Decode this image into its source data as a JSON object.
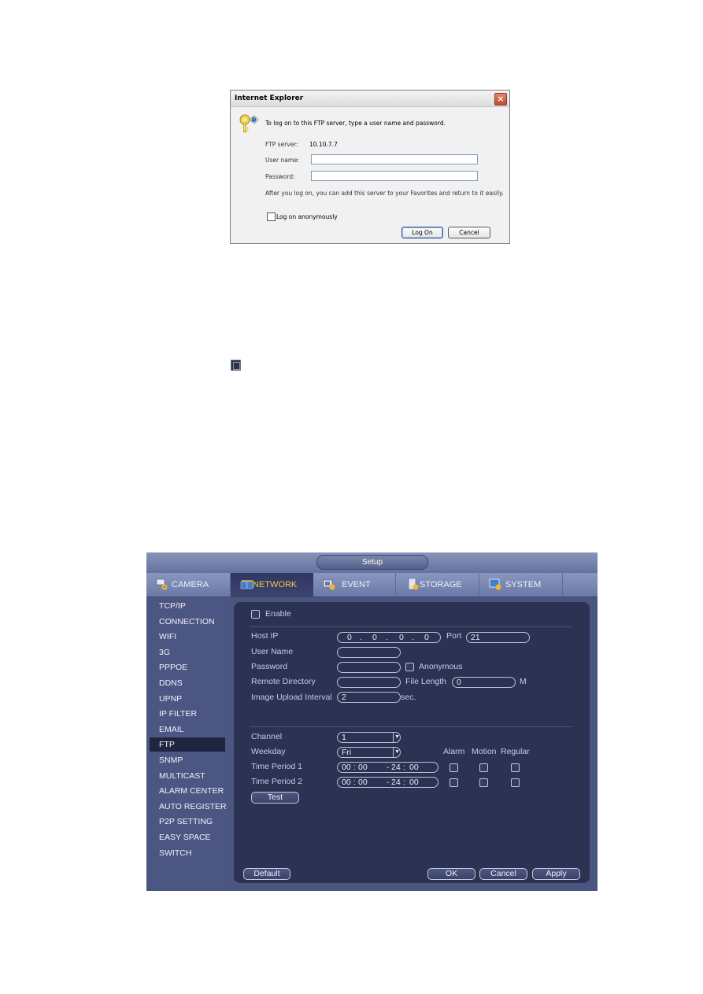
{
  "ie_dialog": {
    "title": "Internet Explorer",
    "close_icon": "close-x-icon",
    "prompt": "To log on to this FTP server, type a user name and password.",
    "ftp_server_label": "FTP server:",
    "ftp_server_value": "10.10.7.7",
    "username_label": "User name:",
    "username_value": "",
    "password_label": "Password:",
    "password_value": "",
    "info_text": "After you log on, you can add this server to your Favorites and return to it easily.",
    "anonymous_label": "Log on anonymously",
    "anonymous_checked": false,
    "logon_button": "Log On",
    "cancel_button": "Cancel"
  },
  "dvr": {
    "title": "Setup",
    "tabs": [
      {
        "label": "CAMERA",
        "icon": "camera-gear-icon"
      },
      {
        "label": "NETWORK",
        "icon": "network-icon",
        "active": true
      },
      {
        "label": "EVENT",
        "icon": "event-icon"
      },
      {
        "label": "STORAGE",
        "icon": "storage-icon"
      },
      {
        "label": "SYSTEM",
        "icon": "system-icon"
      }
    ],
    "sidebar": [
      "TCP/IP",
      "CONNECTION",
      "WIFI",
      "3G",
      "PPPOE",
      "DDNS",
      "UPNP",
      "IP FILTER",
      "EMAIL",
      "FTP",
      "SNMP",
      "MULTICAST",
      "ALARM CENTER",
      "AUTO REGISTER",
      "P2P SETTING",
      "EASY SPACE",
      "SWITCH"
    ],
    "sidebar_active": "FTP",
    "ftp": {
      "enable_label": "Enable",
      "enable_checked": false,
      "host_ip_label": "Host IP",
      "host_ip": [
        "0",
        "0",
        "0",
        "0"
      ],
      "port_label": "Port",
      "port_value": "21",
      "username_label": "User Name",
      "username_value": "",
      "password_label": "Password",
      "password_value": "",
      "anonymous_label": "Anonymous",
      "remote_dir_label": "Remote Directory",
      "remote_dir_value": "",
      "file_length_label": "File Length",
      "file_length_value": "0",
      "file_length_unit": "M",
      "interval_label": "Image Upload Interval",
      "interval_value": "2",
      "interval_unit": "sec.",
      "channel_label": "Channel",
      "channel_value": "1",
      "weekday_label": "Weekday",
      "weekday_value": "Fri",
      "col_alarm": "Alarm",
      "col_motion": "Motion",
      "col_regular": "Regular",
      "period1_label": "Time Period 1",
      "period1_start_h": "00",
      "period1_start_m": "00",
      "period1_end_h": "24",
      "period1_end_m": "00",
      "period2_label": "Time Period 2",
      "period2_start_h": "00",
      "period2_start_m": "00",
      "period2_end_h": "24",
      "period2_end_m": "00",
      "test_button": "Test"
    },
    "buttons": {
      "default": "Default",
      "ok": "OK",
      "cancel": "Cancel",
      "apply": "Apply"
    }
  }
}
